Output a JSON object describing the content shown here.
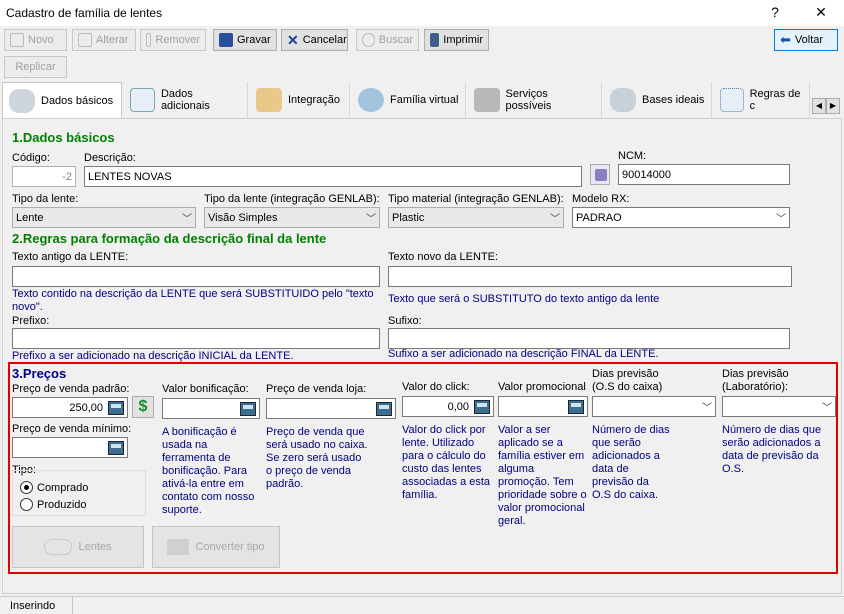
{
  "window": {
    "title": "Cadastro de família de lentes",
    "help": "?",
    "close": "✕"
  },
  "toolbar": {
    "novo": "Novo",
    "alterar": "Alterar",
    "remover": "Remover",
    "gravar": "Gravar",
    "cancelar": "Cancelar",
    "buscar": "Buscar",
    "imprimir": "Imprimir",
    "voltar": "Voltar",
    "replicar": "Replicar"
  },
  "tabs": [
    "Dados básicos",
    "Dados adicionais",
    "Integração",
    "Família virtual",
    "Serviços possíveis",
    "Bases ideais",
    "Regras de c"
  ],
  "tab_scroll": {
    "left": "◀",
    "right": "▶"
  },
  "sec1": {
    "title": "1.Dados básicos",
    "codigo_label": "Código:",
    "codigo": "-2",
    "descricao_label": "Descrição:",
    "descricao": "LENTES NOVAS",
    "ncm_label": "NCM:",
    "ncm": "90014000",
    "tipo_lente_label": "Tipo da lente:",
    "tipo_lente": "Lente",
    "tipo_genlab_label": "Tipo da lente (integração GENLAB):",
    "tipo_genlab": "Visão Simples",
    "material_label": "Tipo material (integração GENLAB):",
    "material": "Plastic",
    "modelo_label": "Modelo RX:",
    "modelo": "PADRAO"
  },
  "sec2": {
    "title": "2.Regras para formação da descrição final da lente",
    "antigo_label": "Texto antigo da LENTE:",
    "antigo_hint": "Texto contido na descrição da LENTE que será SUBSTITUIDO pelo \"texto novo\".",
    "novo_label": "Texto novo da LENTE:",
    "novo_hint": "Texto que será o SUBSTITUTO do texto antigo da lente",
    "prefixo_label": "Prefixo:",
    "prefixo_hint": "Prefixo a ser adicionado na descrição INICIAL da LENTE.",
    "sufixo_label": "Sufixo:",
    "sufixo_hint": "Sufixo a ser adicionado na descrição FINAL da LENTE."
  },
  "sec3": {
    "title": "3.Preços",
    "pv_label": "Preço de venda padrão:",
    "pv": "250,00",
    "pvmin_label": "Preço de venda mínimo:",
    "bon_label": "Valor bonificação:",
    "bon_hint": "A bonificação é usada na ferramenta de bonificação. Para ativá-la entre em contato com nosso suporte.",
    "loja_label": "Preço de venda loja:",
    "loja_hint": "Preço de venda que será usado no caixa. Se zero será usado o preço de venda padrão.",
    "click_label": "Valor do click:",
    "click": "0,00",
    "click_hint": "Valor do click por lente. Utilizado para o cálculo do custo das lentes associadas a esta família.",
    "promo_label": "Valor promocional",
    "promo_hint": "Valor a ser aplicado se a família estiver em alguma promoção. Tem prioridade sobre o valor promocional geral.",
    "dias_caixa_label1": "Dias previsão",
    "dias_caixa_label2": "(O.S do caixa)",
    "dias_caixa_hint": "Número de dias que serão adicionados a data de previsão da O.S do caixa.",
    "dias_lab_label1": "Dias previsão",
    "dias_lab_label2": "(Laboratório):",
    "dias_lab_hint": "Número de dias que serão adicionados a data de previsão da O.S.",
    "tipo_label": "Tipo:",
    "comprado": "Comprado",
    "produzido": "Produzido",
    "lentes_btn": "Lentes",
    "converter_btn": "Converter tipo",
    "currency_symbol": "$"
  },
  "status": {
    "text": "Inserindo"
  }
}
